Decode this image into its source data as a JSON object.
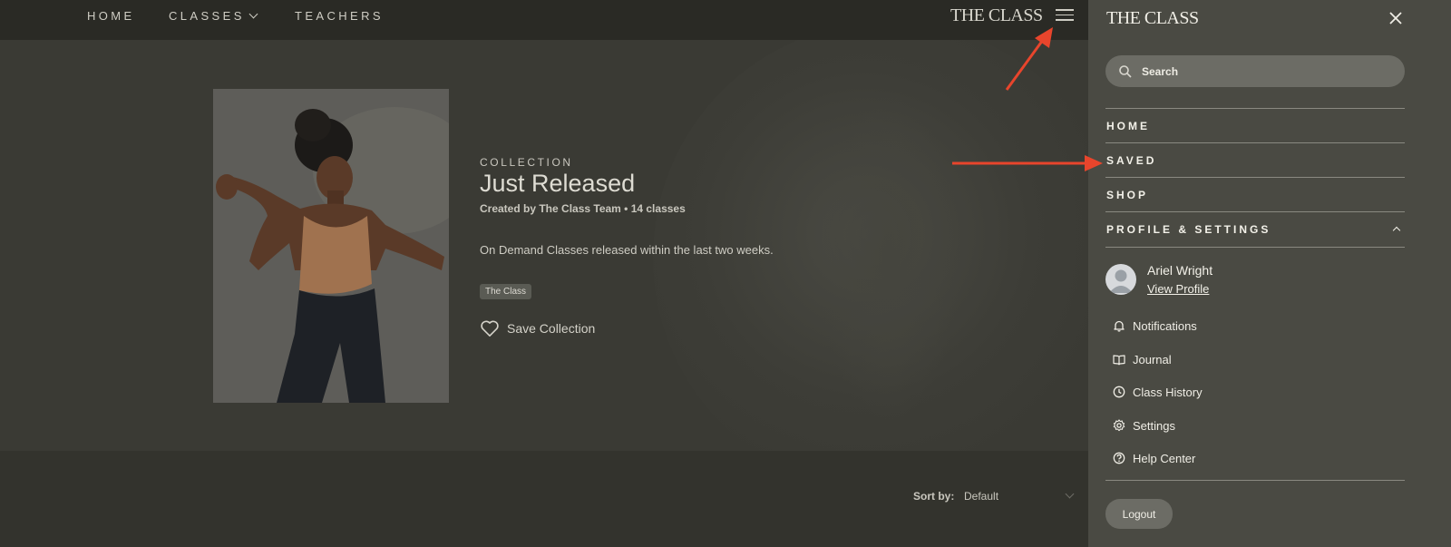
{
  "nav": {
    "home": "HOME",
    "classes": "CLASSES",
    "teachers": "TEACHERS",
    "brand": "THE CLASS",
    "menu_icon": "hamburger-menu-icon"
  },
  "collection": {
    "kicker": "COLLECTION",
    "title": "Just Released",
    "meta": "Created by The Class Team • 14 classes",
    "description": "On Demand Classes released within the last two weeks.",
    "tag": "The Class",
    "save_label": "Save Collection",
    "save_icon": "heart-icon"
  },
  "sort": {
    "label": "Sort by:",
    "value": "Default"
  },
  "sidebar": {
    "brand": "THE CLASS",
    "close_icon": "close-icon",
    "search_placeholder": "Search",
    "items": [
      {
        "label": "HOME"
      },
      {
        "label": "SAVED"
      },
      {
        "label": "SHOP"
      },
      {
        "label": "PROFILE & SETTINGS"
      }
    ],
    "user": {
      "name": "Ariel Wright",
      "view_profile": "View Profile"
    },
    "menu": [
      {
        "label": "Notifications",
        "icon": "bell-icon"
      },
      {
        "label": "Journal",
        "icon": "book-icon"
      },
      {
        "label": "Class History",
        "icon": "clock-icon"
      },
      {
        "label": "Settings",
        "icon": "gear-icon"
      },
      {
        "label": "Help Center",
        "icon": "help-icon"
      }
    ],
    "logout": "Logout"
  },
  "colors": {
    "annotation_arrow": "#e8452c",
    "sidebar_bg": "#4a4a43",
    "page_bg": "#33332d"
  }
}
